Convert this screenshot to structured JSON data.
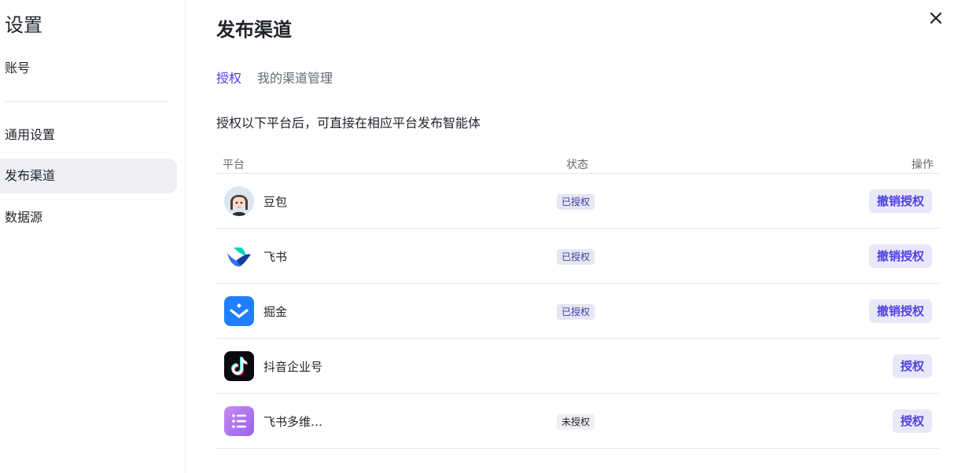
{
  "sidebar": {
    "title": "设置",
    "items": [
      {
        "label": "账号",
        "active": false
      },
      {
        "label": "通用设置",
        "active": false
      },
      {
        "label": "发布渠道",
        "active": true
      },
      {
        "label": "数据源",
        "active": false
      }
    ]
  },
  "main": {
    "title": "发布渠道",
    "tabs": [
      {
        "label": "授权",
        "active": true
      },
      {
        "label": "我的渠道管理",
        "active": false
      }
    ],
    "description": "授权以下平台后，可直接在相应平台发布智能体",
    "table": {
      "headers": {
        "platform": "平台",
        "status": "状态",
        "action": "操作"
      },
      "rows": [
        {
          "name": "豆包",
          "icon": "doubao-avatar-icon",
          "status": "已授权",
          "action": "撤销授权"
        },
        {
          "name": "飞书",
          "icon": "feishu-logo-icon",
          "status": "已授权",
          "action": "撤销授权"
        },
        {
          "name": "掘金",
          "icon": "juejin-logo-icon",
          "status": "已授权",
          "action": "撤销授权"
        },
        {
          "name": "抖音企业号",
          "icon": "douyin-logo-icon",
          "status": "",
          "action": "授权"
        },
        {
          "name": "飞书多维…",
          "icon": "feishu-bitable-icon",
          "status": "未授权",
          "action": "授权"
        }
      ]
    }
  },
  "colors": {
    "accent": "#4e40e5",
    "active_nav_bg": "#efeff6",
    "authorized_badge_bg": "#e6e7f4",
    "action_button_bg": "#e9e8f8"
  }
}
